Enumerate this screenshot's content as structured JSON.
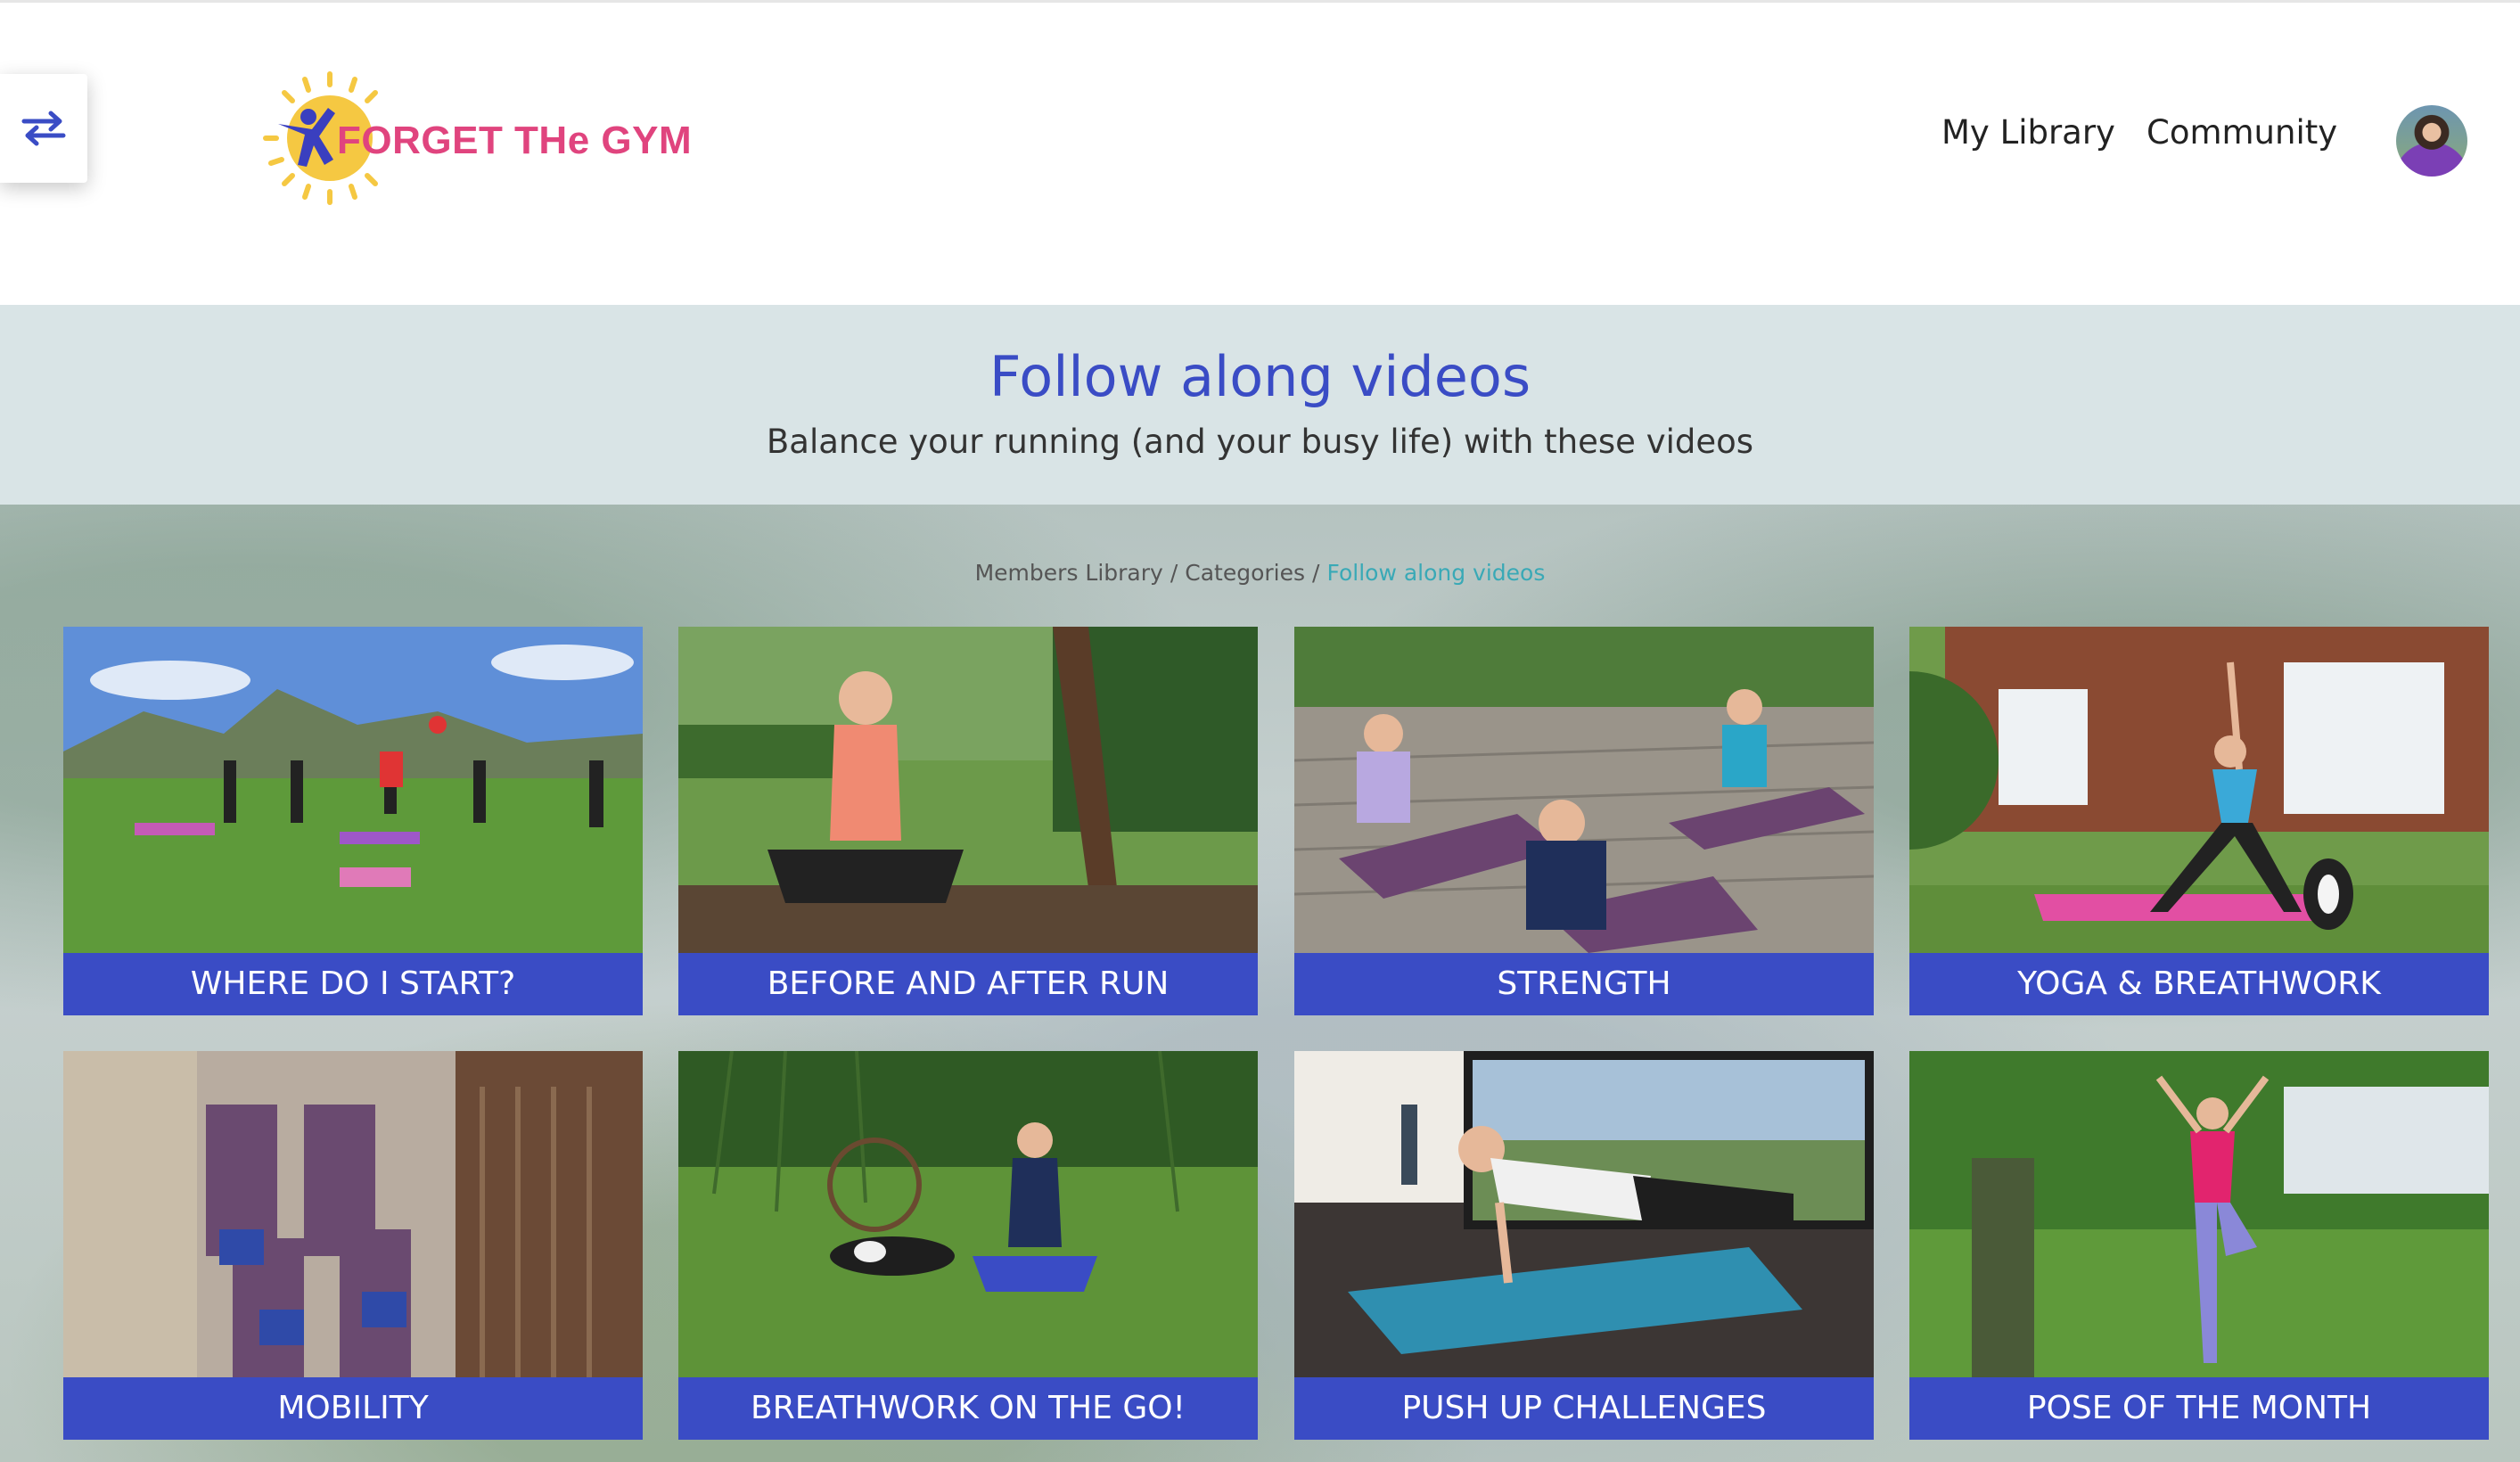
{
  "logo": {
    "text": "FORGET THe GYM"
  },
  "nav": {
    "my_library": "My Library",
    "community": "Community"
  },
  "banner": {
    "title": "Follow along videos",
    "subtitle": "Balance your running (and your busy life) with these videos"
  },
  "breadcrumb": {
    "items": [
      "Members Library",
      "Categories",
      "Follow along videos"
    ],
    "separator": "/"
  },
  "categories": [
    {
      "label": "WHERE DO I START?"
    },
    {
      "label": "BEFORE AND AFTER RUN"
    },
    {
      "label": "STRENGTH"
    },
    {
      "label": "YOGA & BREATHWORK"
    },
    {
      "label": "MOBILITY"
    },
    {
      "label": "BREATHWORK ON THE GO!"
    },
    {
      "label": "PUSH UP CHALLENGES"
    },
    {
      "label": "POSE OF THE MONTH"
    }
  ],
  "colors": {
    "accent": "#3a4cc5",
    "brand_pink": "#e0447e",
    "sun": "#f5c842",
    "banner_bg": "#d9e4e6"
  }
}
